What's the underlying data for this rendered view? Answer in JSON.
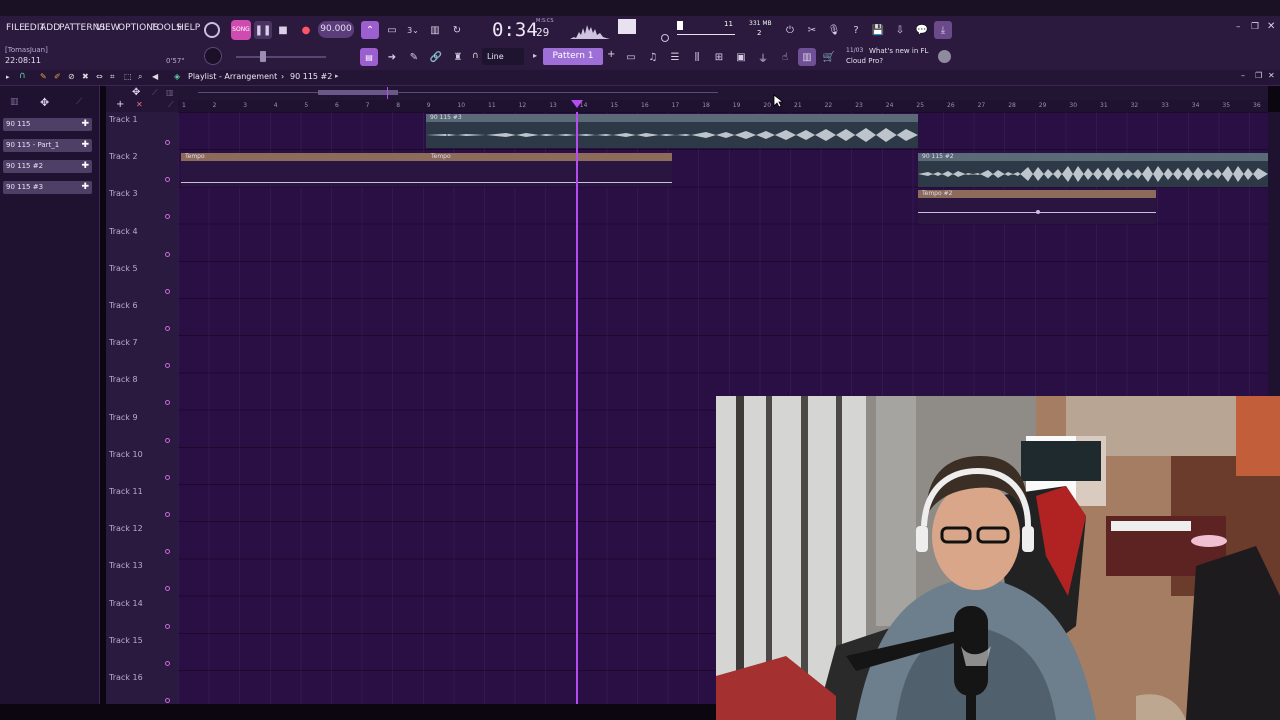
{
  "menu": [
    "FILE",
    "EDIT",
    "ADD",
    "PATTERNS",
    "VIEW",
    "OPTIONS",
    "TOOLS",
    "HELP"
  ],
  "transport": {
    "tempo": "90.000",
    "time": "0:34",
    "time_small": "29",
    "time_unit": "M:S:CS",
    "cpu_value": "11",
    "memory": "331 MB",
    "voices": "2"
  },
  "user": {
    "name": "[TomasJuan]",
    "time": "22:08:11",
    "elapsed": "0'57\""
  },
  "toolbar": {
    "snap": "Line",
    "pattern": "Pattern 1",
    "news_count": "11/03",
    "news_text_1": "What's new in FL",
    "news_text_2": "Cloud Pro?"
  },
  "playlist": {
    "title": "Playlist - Arrangement",
    "breadcrumb": "90 115 #2",
    "bars": [
      "1",
      "2",
      "3",
      "4",
      "5",
      "6",
      "7",
      "8",
      "9",
      "10",
      "11",
      "12",
      "13",
      "14",
      "15",
      "16",
      "17",
      "18",
      "19",
      "20",
      "21",
      "22",
      "23",
      "24",
      "25",
      "26",
      "27",
      "28",
      "29",
      "30",
      "31",
      "32",
      "33",
      "34",
      "35",
      "36"
    ]
  },
  "patterns": [
    "90 115",
    "90 115 - Part_1",
    "90 115 #2",
    "90 115 #3"
  ],
  "tracks": [
    "Track 1",
    "Track 2",
    "Track 3",
    "Track 4",
    "Track 5",
    "Track 6",
    "Track 7",
    "Track 8",
    "Track 9",
    "Track 10",
    "Track 11",
    "Track 12",
    "Track 13",
    "Track 14",
    "Track 15",
    "Track 16"
  ],
  "clips": {
    "audio1": "90 115 #3",
    "tempo1": "Tempo",
    "tempo1b": "Tempo",
    "audio2": "90 115 #2",
    "tempo2": "Tempo #2"
  },
  "colors": {
    "accent": "#9b5fd0",
    "grid": "#2a0f45",
    "playhead": "#b44cf0",
    "audio_clip": "#5b6a77",
    "tempo_clip": "#8c6b5a"
  }
}
